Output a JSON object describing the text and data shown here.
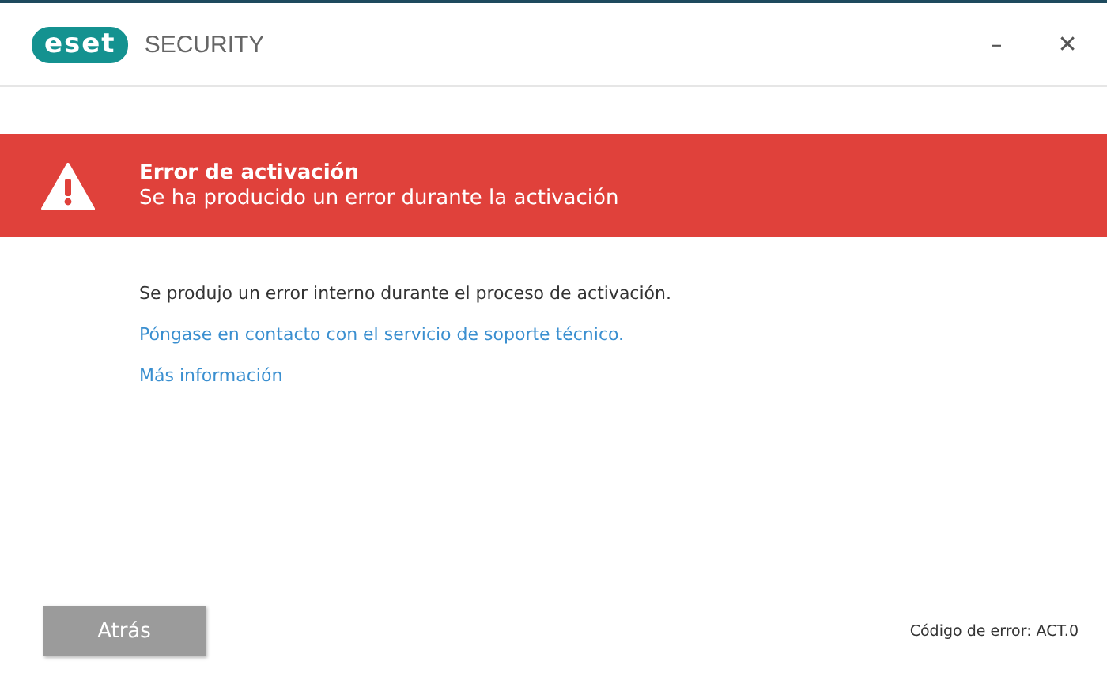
{
  "header": {
    "logo": "eset",
    "product": "SECURITY",
    "minimize": "–",
    "close": "✕"
  },
  "banner": {
    "title": "Error de activación",
    "subtitle": "Se ha producido un error durante la activación"
  },
  "message": "Se produjo un error interno durante el proceso de activación.",
  "links": [
    "Póngase en contacto con el servicio de soporte técnico.",
    "Más información"
  ],
  "footer": {
    "back_button": "Atrás",
    "error_code": "Código de error: ACT.0"
  }
}
